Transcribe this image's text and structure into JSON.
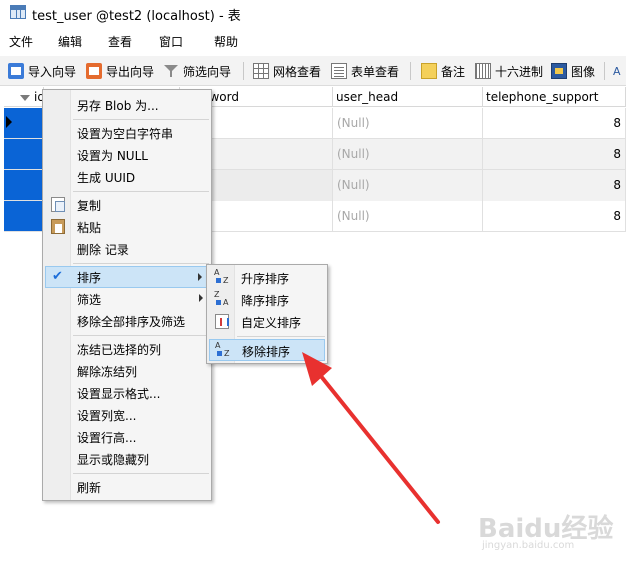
{
  "window": {
    "title": "test_user @test2 (localhost) - 表"
  },
  "menubar": [
    "文件",
    "编辑",
    "查看",
    "窗口",
    "帮助"
  ],
  "toolbar": {
    "import": "导入向导",
    "export": "导出向导",
    "filter": "筛选向导",
    "grid_view": "网格查看",
    "form_view": "表单查看",
    "note": "备注",
    "hex": "十六进制",
    "image": "图像",
    "font_icon": "A"
  },
  "grid": {
    "columns": [
      "id",
      "password",
      "user_head",
      "telephone_support"
    ],
    "rows": [
      {
        "user_head": "(Null)",
        "telephone_support": "8"
      },
      {
        "user_head": "(Null)",
        "telephone_support": "8"
      },
      {
        "user_head": "(Null)",
        "telephone_support": "8"
      },
      {
        "user_head": "(Null)",
        "telephone_support": "8"
      }
    ]
  },
  "context_menu": {
    "save_blob": "另存 Blob 为...",
    "set_empty": "设置为空白字符串",
    "set_null": "设置为 NULL",
    "gen_uuid": "生成 UUID",
    "copy": "复制",
    "paste": "粘贴",
    "delete_record": "删除 记录",
    "sort": "排序",
    "filter": "筛选",
    "remove_all_sort_filter": "移除全部排序及筛选",
    "freeze_columns": "冻结已选择的列",
    "unfreeze_columns": "解除冻结列",
    "display_format": "设置显示格式...",
    "column_width": "设置列宽...",
    "row_height": "设置行高...",
    "show_hide_columns": "显示或隐藏列",
    "refresh": "刷新"
  },
  "sort_submenu": {
    "ascending": "升序排序",
    "descending": "降序排序",
    "custom": "自定义排序",
    "remove": "移除排序"
  },
  "watermark": {
    "brand": "Baidu经验",
    "url": "jingyan.baidu.com"
  },
  "colors": {
    "selection": "#0a64d6",
    "menu_highlight": "#cce4f7",
    "annotation_arrow": "#e8312f"
  }
}
